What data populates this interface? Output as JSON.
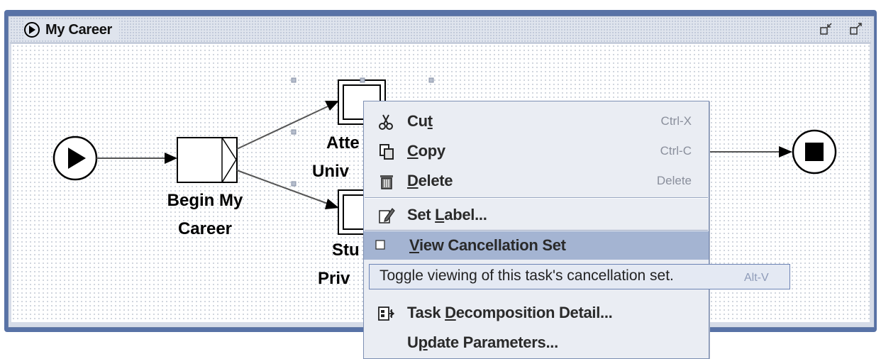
{
  "window": {
    "title": "My Career"
  },
  "diagram": {
    "tasks": [
      {
        "label_lines": [
          "Begin My",
          "Career"
        ]
      },
      {
        "label_lines": [
          "Atte",
          "Univ"
        ]
      },
      {
        "label_lines": [
          "Stu",
          "Priv"
        ]
      }
    ]
  },
  "context_menu": {
    "items": [
      {
        "icon": "scissors-icon",
        "label": "Cut",
        "mnemonic_index": 2,
        "accelerator": "Ctrl-X"
      },
      {
        "icon": "copy-icon",
        "label": "Copy",
        "mnemonic_index": 0,
        "accelerator": "Ctrl-C"
      },
      {
        "icon": "trash-icon",
        "label": "Delete",
        "mnemonic_index": 0,
        "accelerator": "Delete"
      },
      {
        "icon": "pencil-label-icon",
        "label": "Set Label...",
        "mnemonic_index": 4,
        "accelerator": ""
      },
      {
        "icon": "checkbox-icon",
        "label": "View Cancellation Set",
        "mnemonic_index": 0,
        "accelerator": "",
        "selected": true
      },
      {
        "icon": "decomposition-icon",
        "label": "Task Decomposition Detail...",
        "mnemonic_index": 5,
        "accelerator": ""
      },
      {
        "icon": "",
        "label": "Update Parameters...",
        "mnemonic_index": 1,
        "accelerator": ""
      }
    ]
  },
  "tooltip": {
    "text": "Toggle viewing of this task's cancellation set.",
    "accelerator": "Alt-V"
  }
}
